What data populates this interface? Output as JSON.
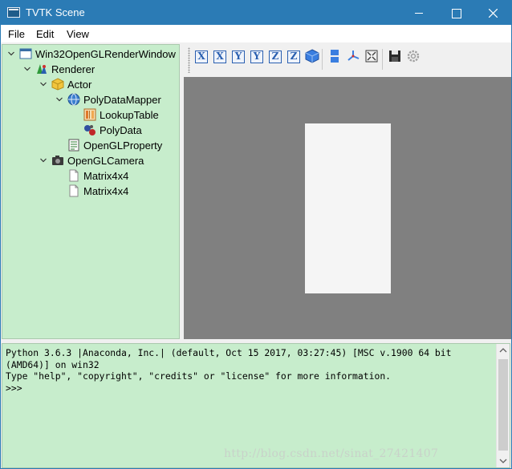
{
  "window": {
    "title": "TVTK Scene",
    "minimize_icon": "minimize-icon",
    "maximize_icon": "maximize-icon",
    "close_icon": "close-icon"
  },
  "menu": [
    "File",
    "Edit",
    "View"
  ],
  "tree": [
    {
      "label": "Win32OpenGLRenderWindow",
      "depth": 0,
      "expanded": true,
      "icon": "render-window-icon"
    },
    {
      "label": "Renderer",
      "depth": 1,
      "expanded": true,
      "icon": "renderer-icon"
    },
    {
      "label": "Actor",
      "depth": 2,
      "expanded": true,
      "icon": "actor-cube-icon"
    },
    {
      "label": "PolyDataMapper",
      "depth": 3,
      "expanded": true,
      "icon": "mapper-globe-icon"
    },
    {
      "label": "LookupTable",
      "depth": 4,
      "icon": "lookup-table-icon"
    },
    {
      "label": "PolyData",
      "depth": 4,
      "icon": "polydata-icon"
    },
    {
      "label": "OpenGLProperty",
      "depth": 3,
      "icon": "property-sheet-icon"
    },
    {
      "label": "OpenGLCamera",
      "depth": 2,
      "expanded": true,
      "icon": "camera-icon"
    },
    {
      "label": "Matrix4x4",
      "depth": 3,
      "icon": "document-icon"
    },
    {
      "label": "Matrix4x4",
      "depth": 3,
      "icon": "document-icon"
    }
  ],
  "toolbar": {
    "view_buttons": [
      {
        "letter": "X",
        "icon": "view-x-plus-icon"
      },
      {
        "letter": "X",
        "icon": "view-x-minus-icon"
      },
      {
        "letter": "Y",
        "icon": "view-y-plus-icon"
      },
      {
        "letter": "Y",
        "icon": "view-y-minus-icon"
      },
      {
        "letter": "Z",
        "icon": "view-z-plus-icon"
      },
      {
        "letter": "Z",
        "icon": "view-z-minus-icon"
      }
    ],
    "other_icons": [
      "isometric-cube-icon",
      "parallel-projection-icon",
      "axes-icon",
      "fullscreen-icon",
      "save-icon",
      "gear-icon"
    ]
  },
  "console": {
    "lines": [
      "Python 3.6.3 |Anaconda, Inc.| (default, Oct 15 2017, 03:27:45) [MSC v.1900 64 bit",
      "(AMD64)] on win32",
      "Type \"help\", \"copyright\", \"credits\" or \"license\" for more information.",
      ">>>"
    ]
  },
  "watermark": "http://blog.csdn.net/sinat_27421407",
  "colors": {
    "titlebar": "#2b7bb5",
    "panel_bg": "#c7edcc",
    "render_bg": "#808080",
    "object": "#f5f5f5",
    "toolbar_blue": "#2a5fb0"
  }
}
